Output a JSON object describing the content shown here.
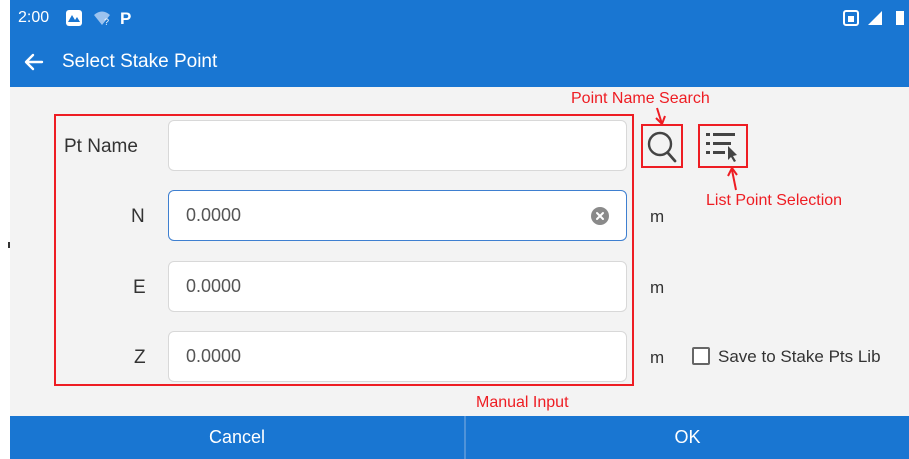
{
  "status": {
    "time": "2:00",
    "icons": [
      "photos-icon",
      "wifi-question-icon",
      "parking-icon",
      "sim-card-icon",
      "signal-icon"
    ]
  },
  "appbar": {
    "title": "Select Stake Point"
  },
  "form": {
    "pt_name_label": "Pt Name",
    "pt_name_value": "",
    "n_label": "N",
    "n_value": "0.0000",
    "e_label": "E",
    "e_value": "0.0000",
    "z_label": "Z",
    "z_value": "0.0000",
    "unit": "m",
    "save_label": "Save to Stake Pts Lib"
  },
  "annotations": {
    "point_name_search": "Point Name Search",
    "list_point_selection": "List Point Selection",
    "manual_input": "Manual Input"
  },
  "buttons": {
    "cancel": "Cancel",
    "ok": "OK"
  },
  "colors": {
    "primary": "#1976d2",
    "annotation": "#ee1d23",
    "background": "#f3f3f3"
  }
}
